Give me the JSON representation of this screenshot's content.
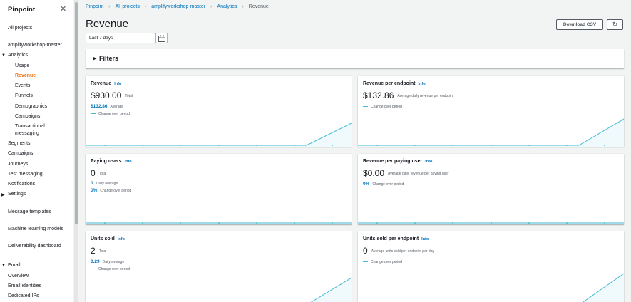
{
  "sidebar": {
    "title": "Pinpoint",
    "all_projects": "All projects",
    "project": "amplifyworkshop-master",
    "analytics": "Analytics",
    "analytics_items": [
      "Usage",
      "Revenue",
      "Events",
      "Funnels",
      "Demographics",
      "Campaigns",
      "Transactional messaging"
    ],
    "segments": "Segments",
    "campaigns": "Campaigns",
    "journeys": "Journeys",
    "test_messaging": "Test messaging",
    "notifications": "Notifications",
    "settings": "Settings",
    "message_templates": "Message templates",
    "machine_learning": "Machine learning models",
    "deliverability": "Deliverability dashboard",
    "email": "Email",
    "email_items": [
      "Overview",
      "Email identities",
      "Dedicated IPs"
    ]
  },
  "breadcrumb": [
    "Pinpoint",
    "All projects",
    "amplifyworkshop-master",
    "Analytics",
    "Revenue"
  ],
  "page_title": "Revenue",
  "download_csv": "Download CSV",
  "date_range": "Last 7 days",
  "filters_label": "Filters",
  "info_label": "Info",
  "chart_color": "#44b9d6",
  "cards": {
    "revenue": {
      "title": "Revenue",
      "value": "$930.00",
      "value_label": "Total",
      "stat_value": "$132.86",
      "stat_label": "Average",
      "legend": "Change over period"
    },
    "revenue_per_endpoint": {
      "title": "Revenue per endpoint",
      "value": "$132.86",
      "value_label": "Average daily revenue per endpoint",
      "legend": "Change over period"
    },
    "paying_users": {
      "title": "Paying users",
      "value": "0",
      "value_label": "Total",
      "stat_value": "0",
      "stat_label": "Daily average",
      "stat2_value": "0%",
      "stat2_label": "Change over period"
    },
    "revenue_per_paying_user": {
      "title": "Revenue per paying user",
      "value": "$0.00",
      "value_label": "Average daily revenue per paying user",
      "stat_value": "0%",
      "stat_label": "Change over period"
    },
    "units_sold": {
      "title": "Units sold",
      "value": "2",
      "value_label": "Total",
      "stat_value": "0.29",
      "stat_label": "Daily average",
      "legend": "Change over period"
    },
    "units_per_endpoint": {
      "title": "Units sold per endpoint",
      "value": "0",
      "value_label": "Average units sold per endpoint per day",
      "legend": "Change over period"
    }
  }
}
